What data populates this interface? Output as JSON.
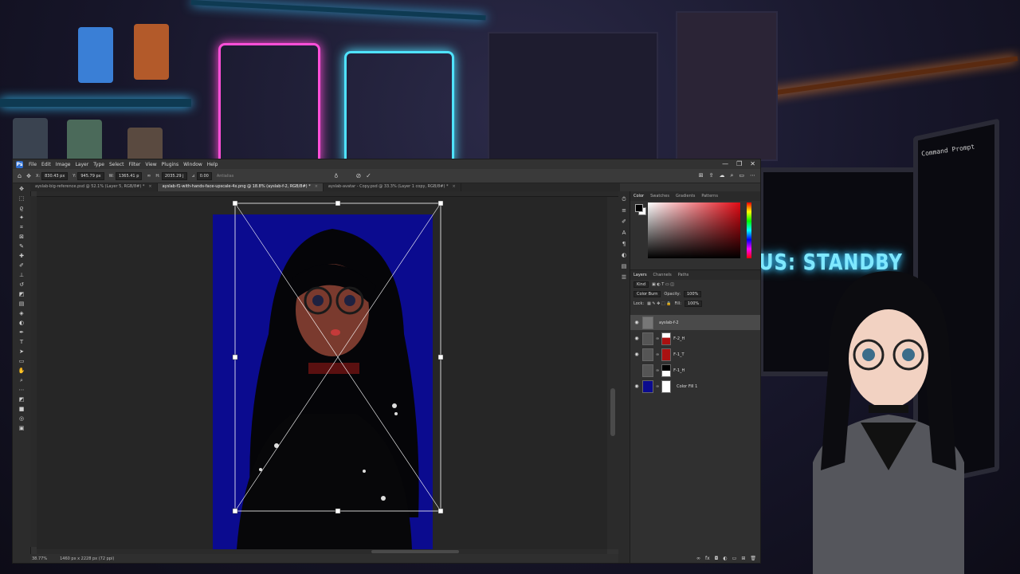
{
  "background": {
    "status_sign": "US: STANDBY",
    "terminal_title": "Command Prompt"
  },
  "app": {
    "logo": "Ps",
    "menu": [
      "File",
      "Edit",
      "Image",
      "Layer",
      "Type",
      "Select",
      "Filter",
      "View",
      "Plugins",
      "Window",
      "Help"
    ],
    "window_controls": [
      "—",
      "❐",
      "✕"
    ]
  },
  "options_bar": {
    "x_label": "X:",
    "x_value": "830.43 px",
    "y_label": "Y:",
    "y_value": "945.79 px",
    "w_label": "W:",
    "w_value": "1365.41 p",
    "h_label": "H:",
    "h_value": "2035.29 j",
    "angle_label": "⊿",
    "angle_value": "0.00",
    "interp": "Antialias",
    "cancel": "⊘",
    "commit": "✓"
  },
  "tabs": [
    {
      "label": "ayslab-big-reference.psd @ 52.1% (Layer 5, RGB/8#) *",
      "active": false
    },
    {
      "label": "ayslab-f1-with-hands-face-upscale-4x.png @ 18.8% (ayslab-f-2, RGB/8#) *",
      "active": true
    },
    {
      "label": "ayslab-avatar - Copy.psd @ 33.3% (Layer 1 copy, RGB/8#) *",
      "active": false
    }
  ],
  "status_bar": {
    "zoom": "38.77%",
    "doc_size": "1460 px x 2228 px (72 ppi)"
  },
  "color_panel": {
    "tabs": [
      "Color",
      "Swatches",
      "Gradients",
      "Patterns"
    ],
    "foreground": "#000000",
    "background": "#ffffff",
    "picker_hue": "#e10a14"
  },
  "layers_panel": {
    "tabs": [
      "Layers",
      "Channels",
      "Paths"
    ],
    "search": "Kind",
    "blend_mode": "Color Burn",
    "opacity_label": "Opacity:",
    "opacity": "100%",
    "lock_label": "Lock:",
    "fill_label": "Fill:",
    "fill": "100%",
    "layers": [
      {
        "name": "ayslab-f-2",
        "visible": true,
        "selected": true
      },
      {
        "name": "F-2_H",
        "visible": true,
        "selected": false
      },
      {
        "name": "F-1_T",
        "visible": true,
        "selected": false
      },
      {
        "name": "F-1_H",
        "visible": false,
        "selected": false
      },
      {
        "name": "Color Fill 1",
        "visible": true,
        "selected": false
      }
    ]
  },
  "canvas": {
    "doc_color": "#0b0b8f"
  }
}
